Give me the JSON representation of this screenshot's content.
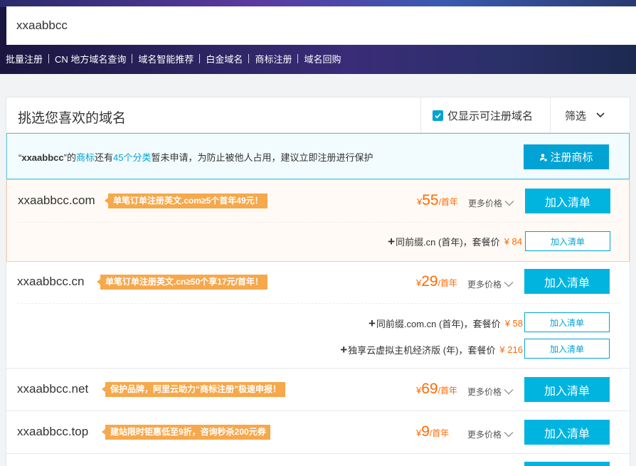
{
  "search": {
    "value": "xxaabbcc"
  },
  "quick_links": [
    "批量注册",
    "CN 地方域名查询",
    "域名智能推荐",
    "白金域名",
    "商标注册",
    "域名回购"
  ],
  "panel": {
    "title": "挑选您喜欢的域名",
    "only_available_label": "仅显示可注册域名",
    "filter_label": "筛选"
  },
  "notice": {
    "quote_open": "“",
    "keyword": "xxaabbcc",
    "quote_close": "”",
    "text_de": "的",
    "trademark_link": "商标",
    "text_still": "还有",
    "categories_link": "45个分类",
    "text_rest": "暂未申请，为防止被他人占用，建议立即注册进行保护",
    "button": "注册商标"
  },
  "common": {
    "currency": "¥",
    "per_year": "/首年",
    "more_prices": "更多价格",
    "add_to_list": "加入清单"
  },
  "domains": [
    {
      "name": "xxaabbcc.com",
      "promo": "单笔订单注册英文.com≥5个首年49元！",
      "price": "55",
      "bundles": [
        {
          "text": "同前缀.cn (首年)，套餐价",
          "price": "¥ 84"
        }
      ]
    },
    {
      "name": "xxaabbcc.cn",
      "promo": "单笔订单注册英文.cn≥50个享17元/首年！",
      "price": "29",
      "bundles": [
        {
          "text": "同前缀.com.cn (首年)，套餐价",
          "price": "¥ 58"
        },
        {
          "text": "独享云虚拟主机经济版 (年)，套餐价",
          "price": "¥ 216"
        }
      ]
    },
    {
      "name": "xxaabbcc.net",
      "promo": "保护品牌，阿里云助力“商标注册”极速申报！",
      "price": "69",
      "bundles": []
    },
    {
      "name": "xxaabbcc.top",
      "promo": "建站限时钜惠低至9折，咨询秒杀200元券",
      "price": "9",
      "bundles": []
    }
  ]
}
